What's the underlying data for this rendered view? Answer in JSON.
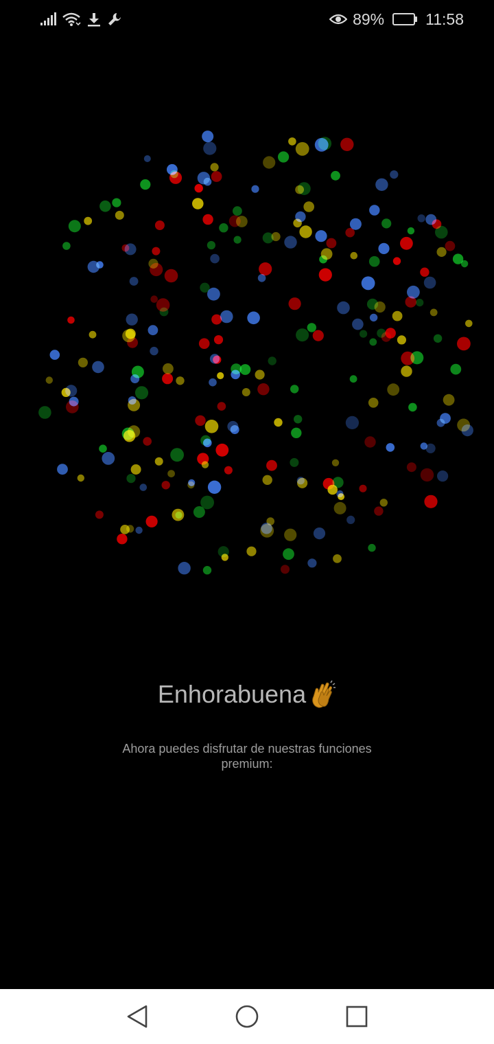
{
  "status_bar": {
    "battery_percent": "89%",
    "battery_level": 0.89,
    "time": "11:58",
    "icons": [
      "signal-icon",
      "wifi-icon",
      "download-icon",
      "wrench-icon",
      "eye-icon",
      "battery-icon"
    ]
  },
  "celebration": {
    "title": "Enhorabuena",
    "emoji_icon": "clapping-hands-icon",
    "subtitle": "Ahora puedes disfrutar de nuestras funciones premium:"
  },
  "confetti": {
    "colors": {
      "red": "#e00000",
      "yellow": "#d4c000",
      "green": "#0fa020",
      "blue": "#3d74e0"
    }
  },
  "nav_bar": {
    "buttons": [
      "back-button",
      "home-button",
      "recents-button"
    ]
  }
}
